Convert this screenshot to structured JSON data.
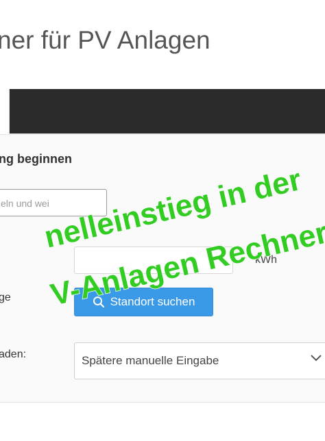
{
  "page": {
    "heading": "ner für PV Anlagen"
  },
  "tabs": {
    "bar_color": "#2b2b2b"
  },
  "form": {
    "section_title": "ng beginnen",
    "select_small_text": "eln und wei",
    "consumption_unit": "kWh",
    "location_label": "ge",
    "location_button": "Standort suchen",
    "load_profile_label": "aden:",
    "load_profile_value": "Spätere manuelle Eingabe"
  },
  "overlay": {
    "line1": "nelleinstieg in der",
    "line2": "V-Anlagen Rechner",
    "color": "#33cc22"
  },
  "colors": {
    "accent": "#3b9ae8",
    "overlay_green": "#33cc22"
  },
  "icons": [
    "search-icon",
    "chevron-down-icon"
  ]
}
